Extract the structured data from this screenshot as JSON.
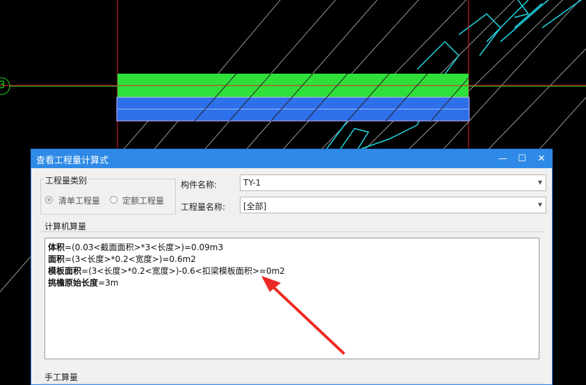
{
  "canvas": {
    "axis_label": "3",
    "colors": {
      "background": "#000000",
      "grid": "#e0202c",
      "axis": "#1fd01f",
      "beam_green": "#2fe03a",
      "beam_blue": "#2e6fea",
      "text_cyan": "#1ed8e6",
      "hatch": "#bdbdbd"
    }
  },
  "dialog": {
    "title": "查看工程量计算式",
    "controls": {
      "minimize": "—",
      "maximize": "☐",
      "close": "✕"
    },
    "category_group": {
      "label": "工程量类别",
      "options": [
        {
          "label": "清单工程量",
          "checked": true
        },
        {
          "label": "定额工程量",
          "checked": false
        }
      ]
    },
    "component_name": {
      "label": "构件名称:",
      "value": "TY-1"
    },
    "quantity_name": {
      "label": "工程量名称:",
      "value": "[全部]"
    },
    "computer_calc": {
      "label": "计算机算量",
      "lines": [
        {
          "name": "体积",
          "expr": "=(0.03<截面面积>*3<长度>)=0.09m3"
        },
        {
          "name": "面积",
          "expr": "=(3<长度>*0.2<宽度>)=0.6m2"
        },
        {
          "name": "模板面积",
          "expr": "=(3<长度>*0.2<宽度>)-0.6<扣梁模板面积>=0m2"
        },
        {
          "name": "挑檐原始长度",
          "expr": "=3m"
        }
      ]
    },
    "manual_calc": {
      "label": "手工算量"
    }
  },
  "annotation": {
    "arrow_color": "#ee2a24"
  }
}
